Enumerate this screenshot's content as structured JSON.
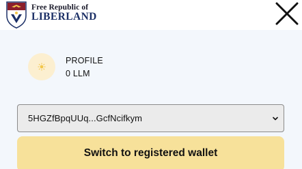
{
  "header": {
    "logo_line1": "Free Republic of",
    "logo_line2": "LIBERLAND"
  },
  "icons": {
    "close": "close-icon",
    "avatar": "sun-icon",
    "seal": "liberland-seal-icon",
    "chevron": "chevron-down-icon"
  },
  "profile": {
    "name": "PROFILE",
    "balance": "0 LLM"
  },
  "wallet": {
    "selected_address": "5HGZfBpqUUq...GcfNcifkym"
  },
  "actions": {
    "switch_label": "Switch to registered wallet"
  },
  "colors": {
    "background": "#f3f7fc",
    "header": "#ffffff",
    "brand_navy": "#1b2f66",
    "brand_red": "#8b1e2b",
    "button_yellow": "#f7e19a",
    "avatar_bg": "#fcefd0",
    "avatar_sun": "#f2c64a"
  }
}
